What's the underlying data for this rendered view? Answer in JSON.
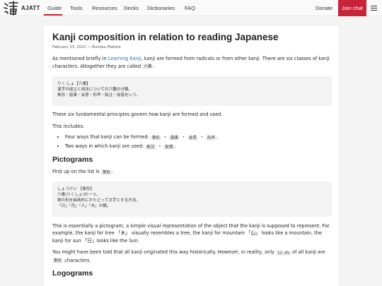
{
  "nav": {
    "logo_text": "AJATT",
    "links": [
      "Guide",
      "Tools",
      "Resources",
      "Decks",
      "Dictionaries",
      "FAQ"
    ],
    "donate": "Donate",
    "join": "Join chat",
    "accent": "#c7243a"
  },
  "article": {
    "title": "Kanji composition in relation to reading Japanese",
    "meta": "February 23, 2021 — Bundou Makoto",
    "intro": {
      "before": "As mentioned briefly in ",
      "link": "Learning Kanji",
      "after": ", kanji are formed from radicals or from other kanji. There are six classes of kanji characters. Altogether they are called ",
      "term": "六書",
      "end": "."
    },
    "quote1": [
      "りく-しょ【六書】",
      "漢字の成立と用法についての六種の分類。",
      "象形・指事・会意・形声・転注・仮借をいう。"
    ],
    "fundamental": "These six fundamental principles govern how kanji are formed and used.",
    "includes": "This includes:",
    "list": {
      "item1_text": "Four ways that kanji can be formed: ",
      "item1_chips": [
        "象形",
        "指事",
        "会意",
        "形声"
      ],
      "item2_text": "Two ways in which kanji are used: ",
      "item2_chips": [
        "転注",
        "仮借"
      ]
    },
    "h_pictograms": "Pictograms",
    "first_up": {
      "before": "First up on the list is ",
      "chip": "象形",
      "end": "."
    },
    "quote2": [
      "しょうけい 【象形】",
      "六書(りくしょ)の一つ。",
      "物の形を絵画的にかたどって文字とする方法。",
      "「日」「月」「人」「木」の類。"
    ],
    "pictogram_para": {
      "a": "This is essentially a pictogram, a simple visual representation of the object that the kanji is supposed to represent. For example, the kanji for ",
      "tree": "tree",
      "b": " 「木」 visually resembles a tree, the kanji for ",
      "mountain": "mountain",
      "c": " 「山」 looks like a mountain, the kanji for ",
      "sun": "sun",
      "d": " 「日」looks like the Sun."
    },
    "history_para": {
      "a": "You might have been told that all kanji originated this way historically. However, in reality, only ",
      "pct": "12.4%",
      "b": " of all kanji are ",
      "chip": "象形",
      "c": " characters."
    },
    "h_logograms": "Logograms"
  },
  "icons": {
    "logo": "kanji-logo-icon",
    "menu": "hamburger-menu-icon"
  }
}
